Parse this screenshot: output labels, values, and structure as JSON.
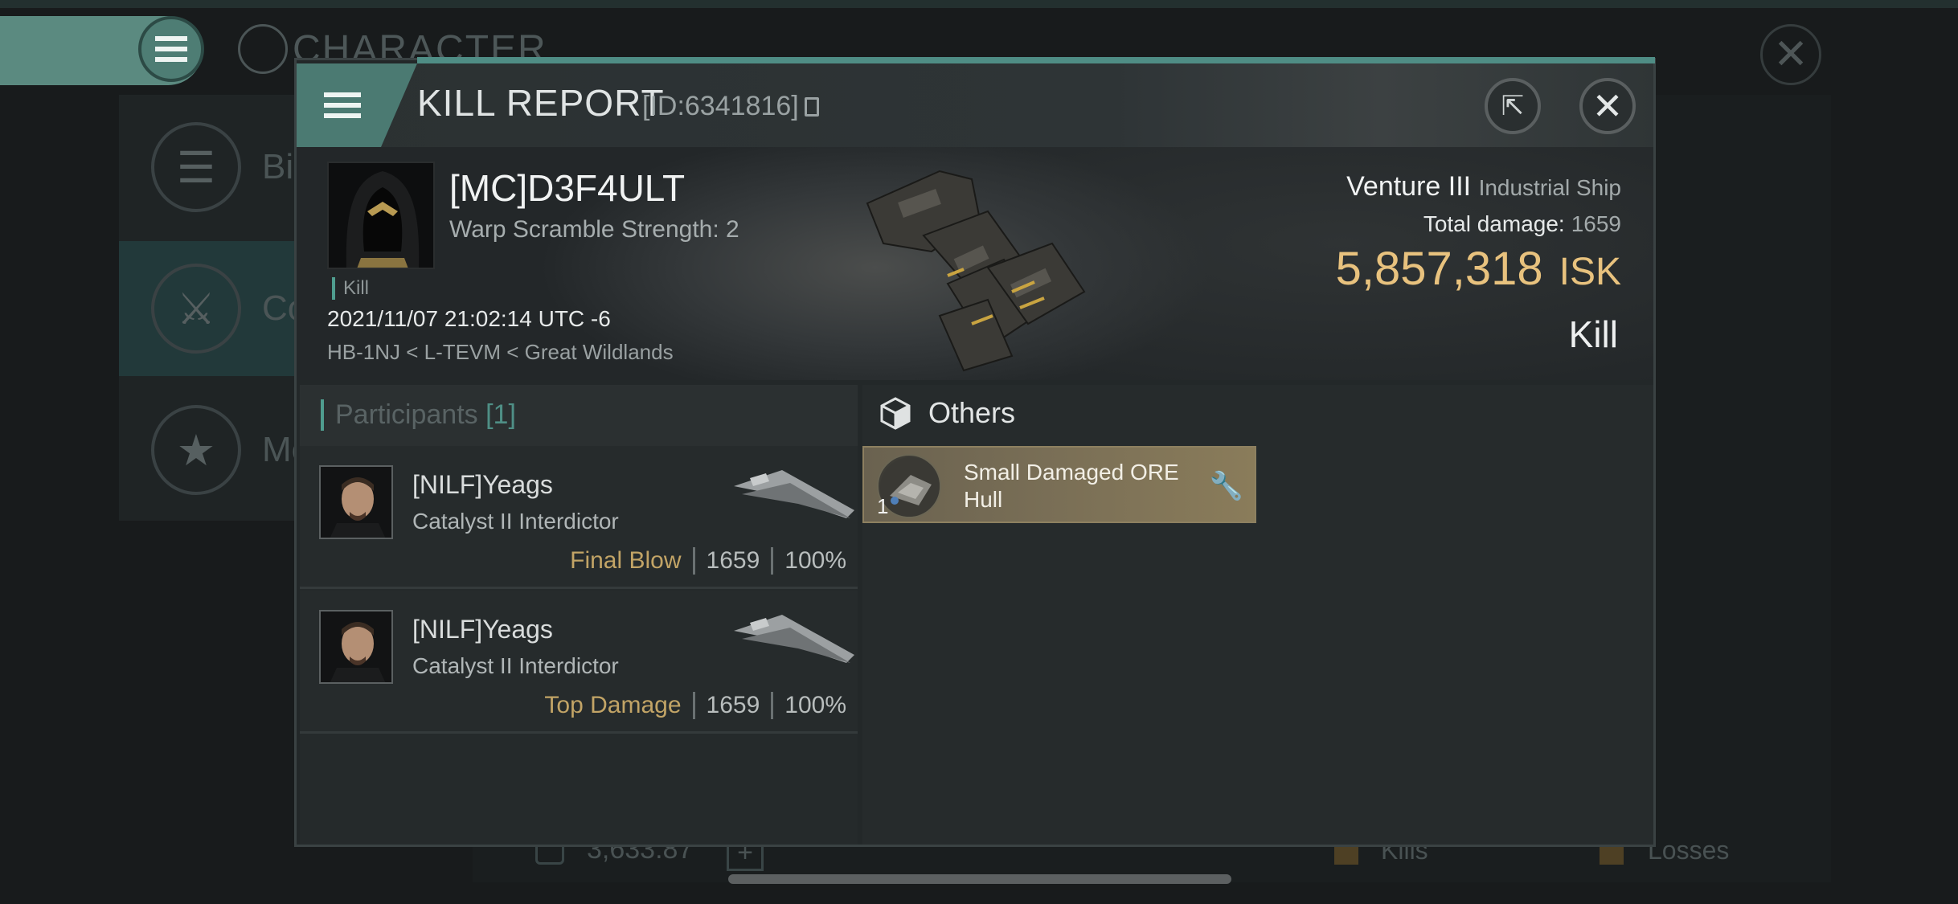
{
  "background": {
    "title": "CHARACTER",
    "side_items": [
      "Bio",
      "Co",
      "Me"
    ],
    "wallet_value": "3,633.87",
    "kills_label": "Kills",
    "losses_label": "Losses"
  },
  "modal": {
    "title": "KILL REPORT",
    "id_text": "[ID:6341816]",
    "victim": {
      "name": "[MC]D3F4ULT",
      "warp": "Warp Scramble Strength: 2",
      "tag": "Kill",
      "datetime": "2021/11/07 21:02:14 UTC -6",
      "location": "HB-1NJ < L-TEVM < Great Wildlands"
    },
    "ship": {
      "name": "Venture III",
      "class": "Industrial Ship",
      "total_damage_label": "Total damage:",
      "total_damage": "1659",
      "isk_value": "5,857,318",
      "isk_unit": "ISK",
      "result": "Kill"
    },
    "participants": {
      "title": "Participants",
      "count": "[1]",
      "rows": [
        {
          "name": "[NILF]Yeags",
          "ship": "Catalyst II Interdictor",
          "label": "Final Blow",
          "damage": "1659",
          "percent": "100%"
        },
        {
          "name": "[NILF]Yeags",
          "ship": "Catalyst II Interdictor",
          "label": "Top Damage",
          "damage": "1659",
          "percent": "100%"
        }
      ]
    },
    "others": {
      "title": "Others",
      "items": [
        {
          "name": "Small Damaged ORE Hull",
          "qty": "1"
        }
      ]
    }
  },
  "colors": {
    "accent": "#4f9d8f",
    "isk": "#e8c27e",
    "final_blow": "#c2a466"
  }
}
